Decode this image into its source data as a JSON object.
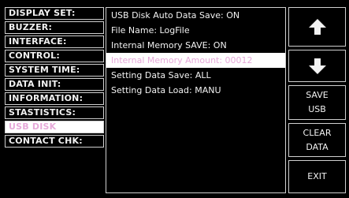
{
  "menu": [
    {
      "label": "DISPLAY SET:",
      "active": false
    },
    {
      "label": "BUZZER:",
      "active": false
    },
    {
      "label": "INTERFACE:",
      "active": false
    },
    {
      "label": "CONTROL:",
      "active": false
    },
    {
      "label": "SYSTEM TIME:",
      "active": false
    },
    {
      "label": "DATA INIT:",
      "active": false
    },
    {
      "label": "INFORMATION:",
      "active": false
    },
    {
      "label": "STASTISTICS:",
      "active": false
    },
    {
      "label": "USB DISK",
      "active": true
    },
    {
      "label": "CONTACT CHK:",
      "active": false
    }
  ],
  "content": [
    {
      "text": "USB Disk Auto Data Save: ON",
      "highlight": false
    },
    {
      "text": "File Name: LogFile",
      "highlight": false
    },
    {
      "text": "Internal Memory SAVE: ON",
      "highlight": false
    },
    {
      "text": "Internal Memory Amount: 00012",
      "highlight": true
    },
    {
      "text": "Setting Data Save: ALL",
      "highlight": false
    },
    {
      "text": "Setting Data Load: MANU",
      "highlight": false
    }
  ],
  "buttons": {
    "up_icon": "arrow-up-icon",
    "down_icon": "arrow-down-icon",
    "save_usb": [
      "SAVE",
      "USB"
    ],
    "clear_data": [
      "CLEAR",
      "DATA"
    ],
    "exit": "EXIT"
  },
  "colors": {
    "background": "#000000",
    "border": "#cfcfcf",
    "text": "#f2f2f2",
    "highlight_bg": "#ffffff",
    "highlight_text": "#e6a9d9"
  }
}
